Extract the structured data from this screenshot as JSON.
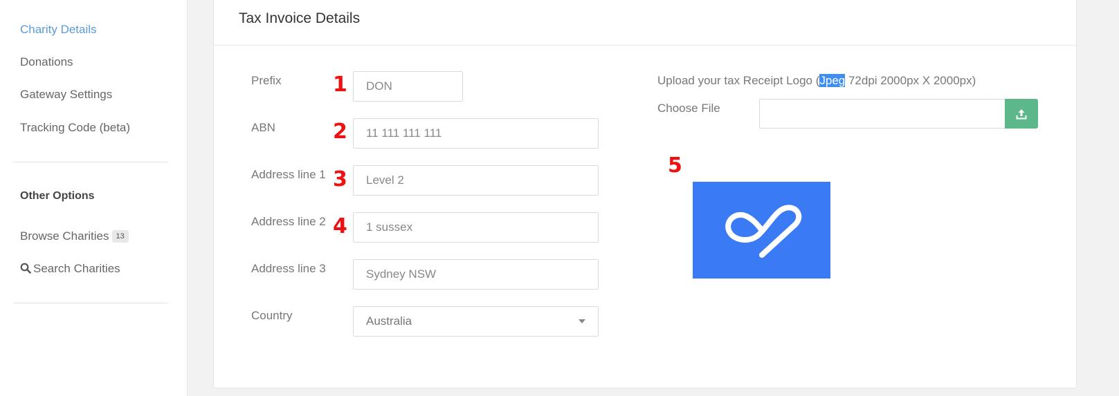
{
  "sidebar": {
    "links": [
      {
        "label": "Charity Details",
        "active": true
      },
      {
        "label": "Donations"
      },
      {
        "label": "Gateway Settings"
      },
      {
        "label": "Tracking Code (beta)"
      }
    ],
    "other_heading": "Other Options",
    "browse_label": "Browse Charities",
    "browse_count": "13",
    "search_label": "Search Charities",
    "search_icon": "search-icon"
  },
  "card": {
    "title": "Tax Invoice Details"
  },
  "form": {
    "prefix": {
      "label": "Prefix",
      "value": "DON"
    },
    "abn": {
      "label": "ABN",
      "value": "11 111 111 111"
    },
    "address1": {
      "label": "Address line 1",
      "value": "Level 2"
    },
    "address2": {
      "label": "Address line 2",
      "value": "1 sussex"
    },
    "address3": {
      "label": "Address line 3",
      "value": "Sydney NSW"
    },
    "country": {
      "label": "Country",
      "value": "Australia"
    }
  },
  "upload": {
    "prefix_text": "Upload your tax Receipt Logo (",
    "highlight_text": "Jpeg",
    "suffix_text": " 72dpi 2000px X 2000px)",
    "choose_label": "Choose File",
    "button_icon": "upload-icon"
  },
  "annotations": {
    "m1": "1",
    "m2": "2",
    "m3": "3",
    "m4": "4",
    "m5": "5"
  },
  "colors": {
    "active_link": "#5b9bd5",
    "upload_button": "#5cb88a",
    "logo_background": "#3b7af5",
    "marker": "#ee1111",
    "highlight": "#3d8ef0"
  }
}
